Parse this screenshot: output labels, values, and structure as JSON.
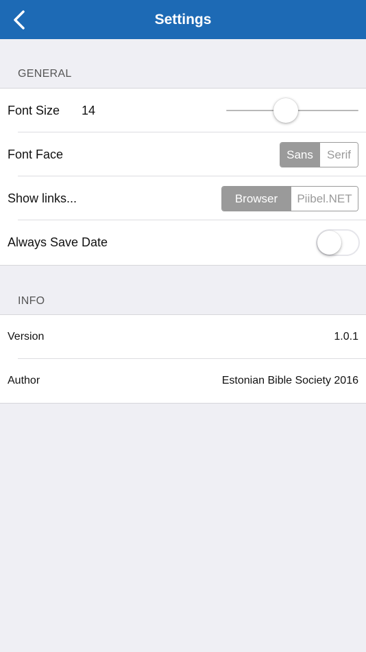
{
  "navbar": {
    "title": "Settings",
    "back_icon": "chevron-left-icon",
    "color": "#1d6ab5"
  },
  "general": {
    "header": "GENERAL",
    "font_size": {
      "label": "Font Size",
      "value": "14",
      "slider_fraction": 0.44
    },
    "font_face": {
      "label": "Font Face",
      "options": [
        "Sans",
        "Serif"
      ],
      "selected": "Sans"
    },
    "show_links": {
      "label": "Show links...",
      "options": [
        "Browser",
        "Piibel.NET"
      ],
      "selected": "Browser"
    },
    "always_save_date": {
      "label": "Always Save Date",
      "on": false
    }
  },
  "info": {
    "header": "INFO",
    "version": {
      "label": "Version",
      "value": "1.0.1"
    },
    "author": {
      "label": "Author",
      "value": "Estonian Bible Society 2016"
    }
  }
}
